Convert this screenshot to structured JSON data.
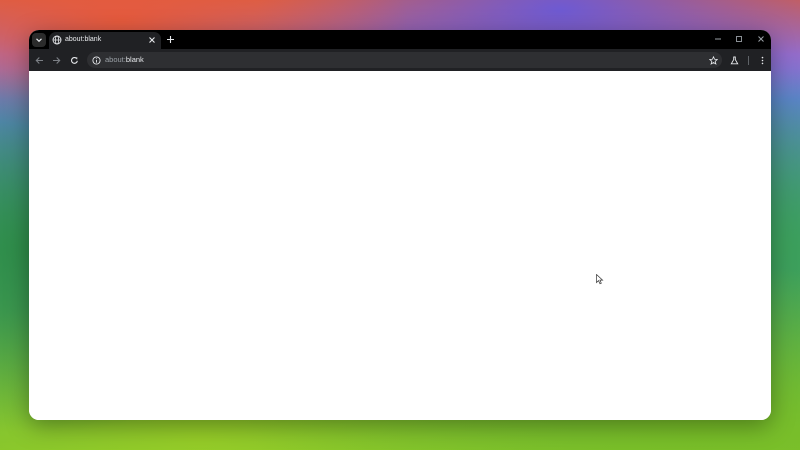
{
  "browser": {
    "tab": {
      "title": "about:blank"
    },
    "omnibox": {
      "scheme": "about:",
      "host": "blank"
    }
  },
  "icons": {
    "tab_search": "chevron-down-icon",
    "favicon": "globe-icon",
    "tab_close": "close-icon",
    "new_tab": "plus-icon",
    "minimize": "minimize-icon",
    "maximize": "maximize-icon",
    "close_window": "close-icon",
    "back": "arrow-left-icon",
    "forward": "arrow-right-icon",
    "reload": "reload-icon",
    "site_info": "info-icon",
    "bookmark": "star-icon",
    "labs": "flask-icon",
    "menu": "kebab-menu-icon"
  },
  "colors": {
    "tab_strip": "#000000",
    "toolbar": "#202124",
    "omnibox": "#2e2f32",
    "page": "#ffffff"
  }
}
